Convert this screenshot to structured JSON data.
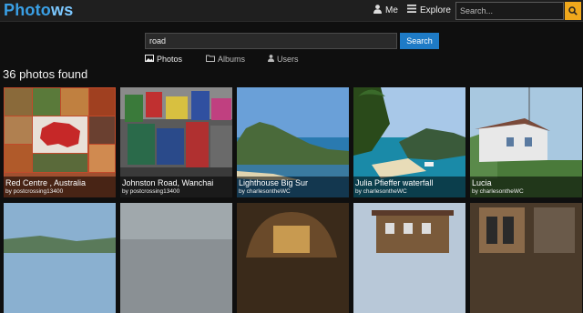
{
  "header": {
    "logo_main": "Photo",
    "logo_accent": "ws",
    "nav": [
      {
        "label": "Me",
        "icon": "user-icon"
      },
      {
        "label": "Explore",
        "icon": "menu-icon"
      }
    ],
    "search_placeholder": "Search...",
    "search_button_icon": "search-icon"
  },
  "search": {
    "query": "road",
    "button_label": "Search",
    "filters": [
      {
        "label": "Photos",
        "icon": "image-icon",
        "active": true
      },
      {
        "label": "Albums",
        "icon": "folder-icon",
        "active": false
      },
      {
        "label": "Users",
        "icon": "user-icon",
        "active": false
      }
    ]
  },
  "results": {
    "count_text": "36 photos found",
    "photos": [
      {
        "title": "Red Centre , Australia",
        "byline": "by postcrossing13400"
      },
      {
        "title": "Johnston Road, Wanchai",
        "byline": "by postcrossing13400"
      },
      {
        "title": "Lighthouse Big Sur",
        "byline": "by charlesontheWC"
      },
      {
        "title": "Julia Pfieffer waterfall",
        "byline": "by charlesontheWC"
      },
      {
        "title": "Lucia",
        "byline": "by charlesontheWC"
      },
      {
        "title": "",
        "byline": ""
      },
      {
        "title": "",
        "byline": ""
      },
      {
        "title": "",
        "byline": ""
      },
      {
        "title": "",
        "byline": ""
      },
      {
        "title": "",
        "byline": ""
      }
    ]
  },
  "colors": {
    "brand": "#3aa0e6",
    "search_button": "#1e7bc6",
    "top_search_button": "#f0a81c"
  }
}
